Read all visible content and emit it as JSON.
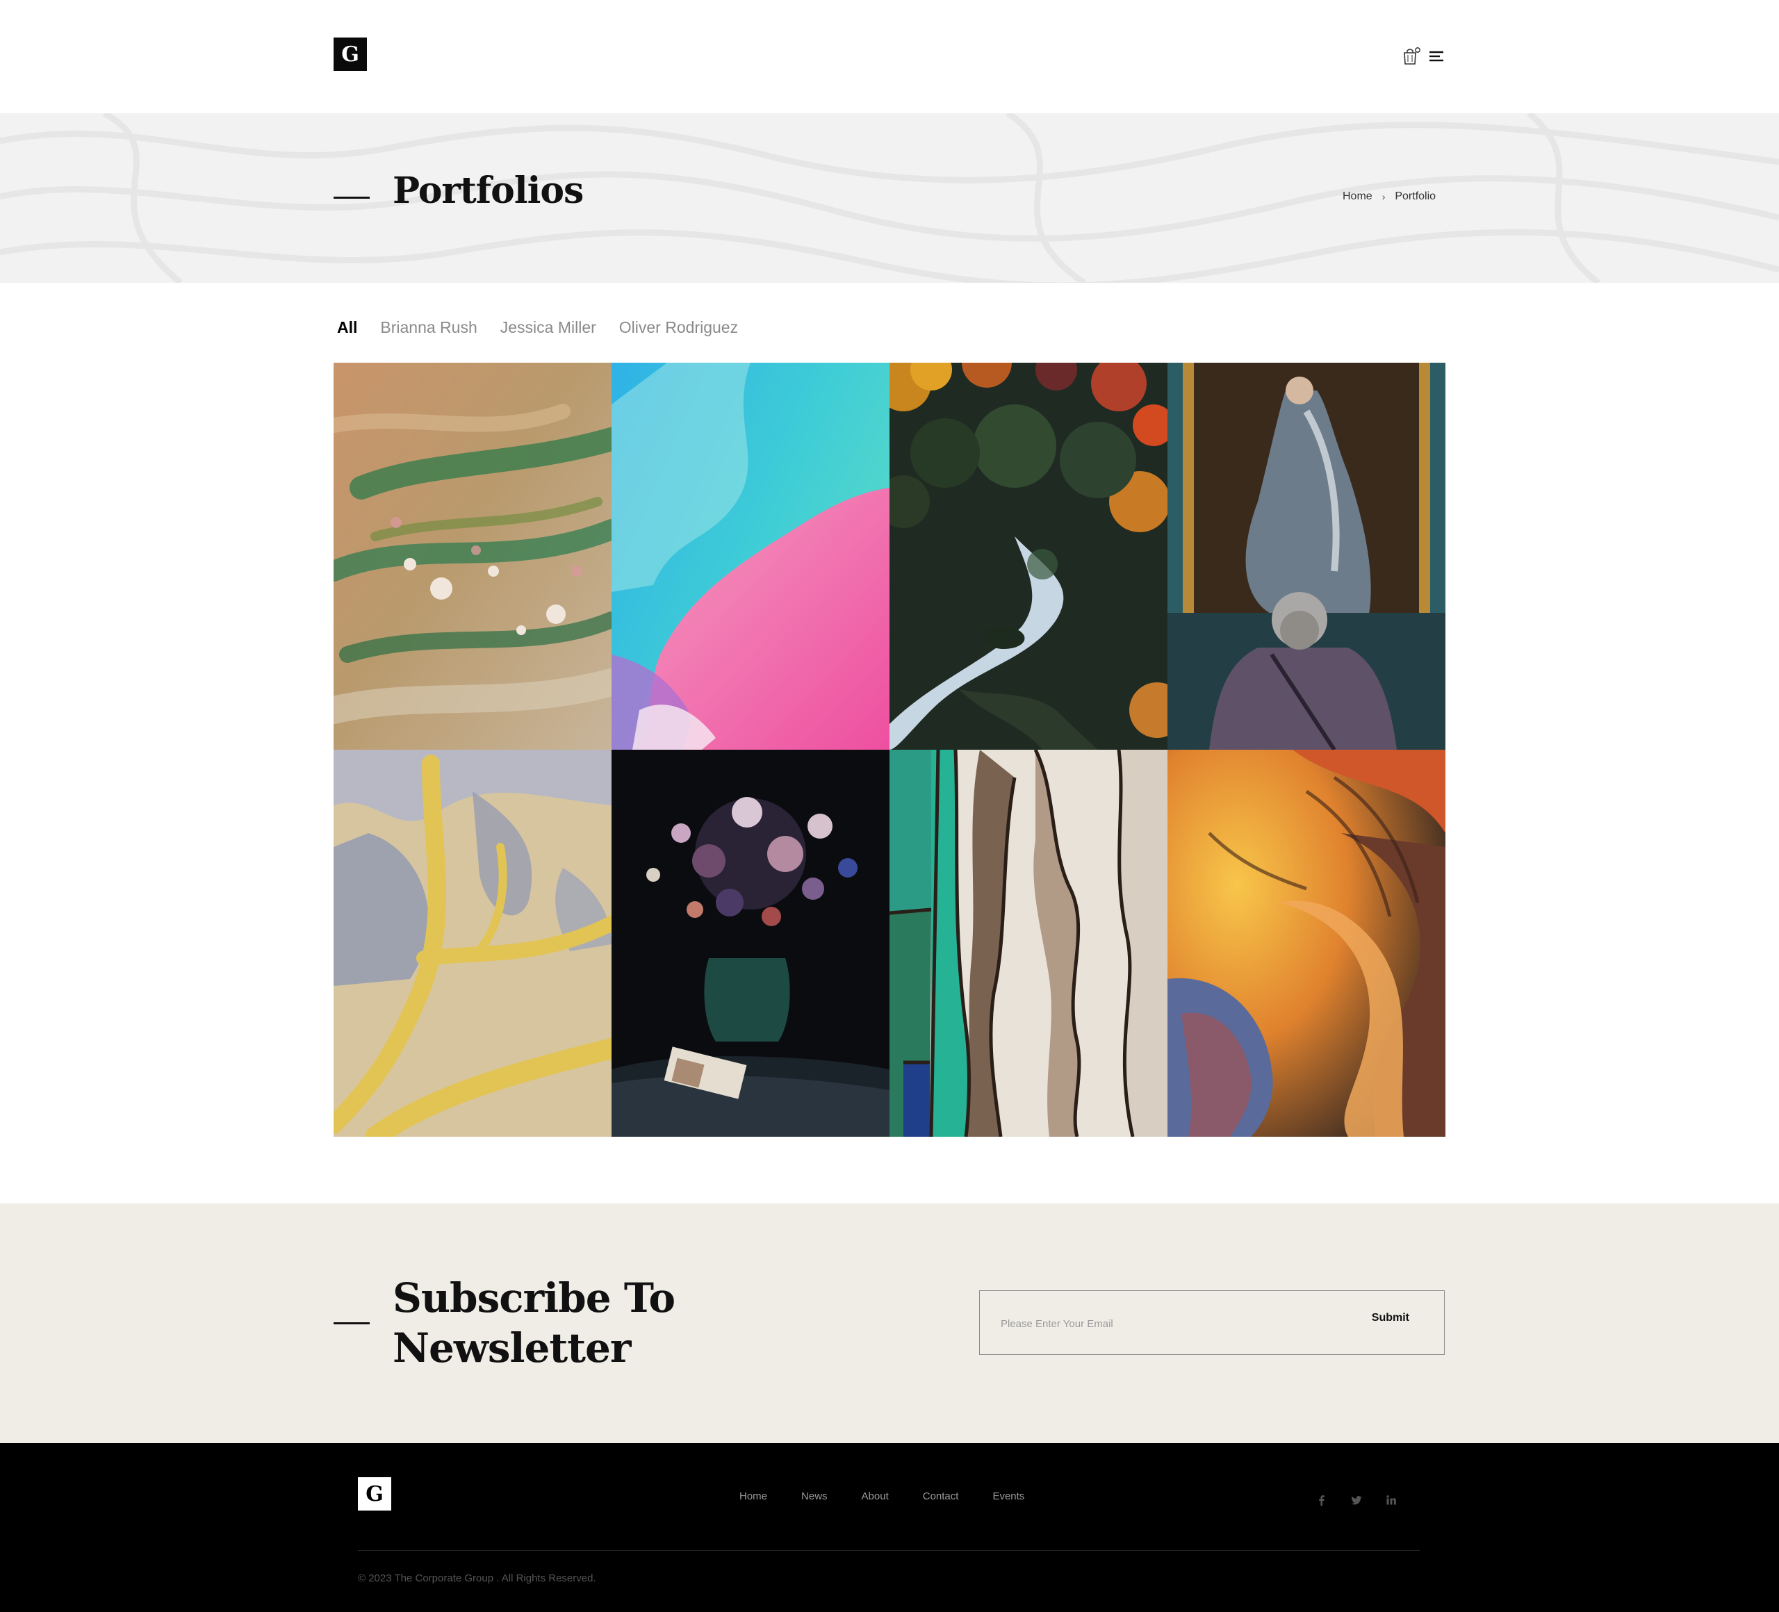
{
  "header": {
    "logo_letter": "G",
    "icons": [
      "cart-icon",
      "menu-icon"
    ],
    "cart_count": "0"
  },
  "title_band": {
    "title": "Portfolios",
    "breadcrumb": [
      "Home",
      "Portfolio"
    ]
  },
  "filters": {
    "tabs": [
      {
        "label": "All",
        "active": true
      },
      {
        "label": "Brianna Rush",
        "active": false
      },
      {
        "label": "Jessica Miller",
        "active": false
      },
      {
        "label": "Oliver Rodriguez",
        "active": false
      }
    ]
  },
  "gallery": {
    "items": [
      {
        "name": "flower-field-painting"
      },
      {
        "name": "blue-pink-abstract"
      },
      {
        "name": "autumn-river-landscape"
      },
      {
        "name": "museum-portrait-visitor"
      },
      {
        "name": "yellow-aerial-terrain"
      },
      {
        "name": "dark-floral-still-life"
      },
      {
        "name": "stained-glass-abstract"
      },
      {
        "name": "colorful-carved-sculpture"
      }
    ]
  },
  "newsletter": {
    "title_line1": "Subscribe To",
    "title_line2": "Newsletter",
    "placeholder": "Please Enter Your Email",
    "submit_label": "Submit"
  },
  "footer": {
    "logo_letter": "G",
    "nav": [
      "Home",
      "News",
      "About",
      "Contact",
      "Events"
    ],
    "social": [
      "facebook-icon",
      "twitter-icon",
      "linkedin-icon"
    ],
    "copyright": "© 2023 The Corporate Group . All Rights Reserved."
  },
  "colors": {
    "title_band_bg": "#f2f2f2",
    "newsletter_bg": "#f0ede7",
    "footer_bg": "#000000",
    "inactive_tab": "#8a8a8a"
  }
}
